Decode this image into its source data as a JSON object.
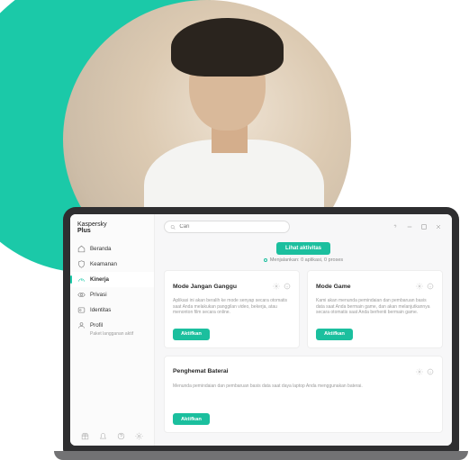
{
  "brand": {
    "line1": "Kaspersky",
    "line2": "Plus"
  },
  "sidebar": {
    "items": [
      {
        "label": "Beranda"
      },
      {
        "label": "Keamanan"
      },
      {
        "label": "Kinerja"
      },
      {
        "label": "Privasi"
      },
      {
        "label": "Identitas"
      },
      {
        "label": "Profil",
        "sub": "Paket langganan aktif"
      }
    ]
  },
  "search": {
    "placeholder": "Cari"
  },
  "actions": {
    "view_activity": "Lihat aktivitas",
    "status": "Menjalankan: 0 aplikasi, 0 proses"
  },
  "cards": {
    "dnd": {
      "title": "Mode Jangan Ganggu",
      "desc": "Aplikasi ini akan beralih ke mode senyap secara otomatis saat Anda melakukan panggilan video, bekerja, atau menonton film secara online.",
      "button": "Aktifkan"
    },
    "game": {
      "title": "Mode Game",
      "desc": "Kami akan menunda pemindaian dan pembaruan basis data saat Anda bermain game, dan akan melanjutkannya secara otomatis saat Anda berhenti bermain game.",
      "button": "Aktifkan"
    },
    "battery": {
      "title": "Penghemat Baterai",
      "desc": "Menunda pemindaian dan pembaruan basis data saat daya laptop Anda menggunakan baterai.",
      "button": "Aktifkan"
    }
  }
}
